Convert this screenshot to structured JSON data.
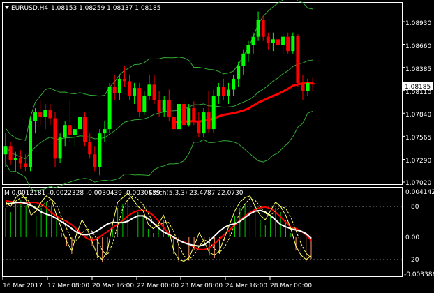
{
  "main_panel": {
    "title": "EURUSD,H4",
    "ohlc": "1.08153 1.08259 1.08137 1.08185",
    "price_ticks": [
      "1.08930",
      "1.08660",
      "1.08385",
      "1.08110",
      "1.07840",
      "1.07565",
      "1.07290",
      "1.07020"
    ],
    "current_price": "1.08185",
    "colors": {
      "bull": "#00ff00",
      "bear": "#ff0000",
      "bands": "#33aa33",
      "ma": "#ff0000",
      "grid": "#ffffff"
    }
  },
  "sub_panel": {
    "macd_label": "M 0.0012181 -0.0022328 -0.0030439 -0.0030439",
    "stoch_label": "Stoch(5,3,3) 23.4787 22.0730",
    "ticks": [
      "0.004142",
      "80",
      "0.00",
      "20",
      "-0.003386"
    ],
    "colors": {
      "hist_pos": "#00cc00",
      "hist_neg": "#ff9966",
      "red_line": "#ff0000",
      "white_line": "#ffffff",
      "stoch": "#ffff66"
    }
  },
  "time_axis": [
    "16 Mar 2017",
    "17 Mar 08:00",
    "20 Mar 16:00",
    "22 Mar 00:00",
    "23 Mar 08:00",
    "24 Mar 16:00",
    "28 Mar 00:00"
  ],
  "chart_data": {
    "type": "candlestick",
    "candles": [
      [
        1.0735,
        1.076,
        1.072,
        1.0745
      ],
      [
        1.0745,
        1.075,
        1.0722,
        1.0728
      ],
      [
        1.0728,
        1.0738,
        1.0715,
        1.0731
      ],
      [
        1.0731,
        1.074,
        1.0718,
        1.0724
      ],
      [
        1.0724,
        1.0735,
        1.0715,
        1.072
      ],
      [
        1.072,
        1.078,
        1.0715,
        1.0775
      ],
      [
        1.0775,
        1.079,
        1.076,
        1.0785
      ],
      [
        1.0785,
        1.08,
        1.077,
        1.078
      ],
      [
        1.078,
        1.0795,
        1.0765,
        1.0788
      ],
      [
        1.0788,
        1.0795,
        1.077,
        1.0778
      ],
      [
        1.0778,
        1.0785,
        1.072,
        1.073
      ],
      [
        1.073,
        1.076,
        1.0725,
        1.0755
      ],
      [
        1.0755,
        1.0775,
        1.0745,
        1.077
      ],
      [
        1.077,
        1.08,
        1.075,
        1.0758
      ],
      [
        1.0758,
        1.077,
        1.0745,
        1.0765
      ],
      [
        1.0765,
        1.079,
        1.075,
        1.078
      ],
      [
        1.078,
        1.0785,
        1.0745,
        1.075
      ],
      [
        1.075,
        1.076,
        1.073,
        1.0735
      ],
      [
        1.0735,
        1.0745,
        1.0715,
        1.072
      ],
      [
        1.072,
        1.0765,
        1.071,
        1.076
      ],
      [
        1.076,
        1.0775,
        1.075,
        1.0765
      ],
      [
        1.0765,
        1.082,
        1.076,
        1.0815
      ],
      [
        1.0815,
        1.083,
        1.08,
        1.0808
      ],
      [
        1.0808,
        1.083,
        1.08,
        1.0825
      ],
      [
        1.0825,
        1.084,
        1.0815,
        1.0822
      ],
      [
        1.0822,
        1.083,
        1.08,
        1.0805
      ],
      [
        1.0805,
        1.082,
        1.0795,
        1.0814
      ],
      [
        1.0814,
        1.082,
        1.078,
        1.0785
      ],
      [
        1.0785,
        1.081,
        1.0782,
        1.0805
      ],
      [
        1.0805,
        1.083,
        1.08,
        1.0818
      ],
      [
        1.0818,
        1.083,
        1.0795,
        1.08
      ],
      [
        1.08,
        1.081,
        1.078,
        1.0785
      ],
      [
        1.0785,
        1.0805,
        1.078,
        1.08
      ],
      [
        1.08,
        1.0812,
        1.0775,
        1.078
      ],
      [
        1.078,
        1.0795,
        1.076,
        1.0765
      ],
      [
        1.0765,
        1.08,
        1.076,
        1.0795
      ],
      [
        1.0795,
        1.0802,
        1.0768,
        1.077
      ],
      [
        1.077,
        1.0795,
        1.0768,
        1.079
      ],
      [
        1.079,
        1.0798,
        1.077,
        1.0775
      ],
      [
        1.0775,
        1.0785,
        1.0755,
        1.076
      ],
      [
        1.076,
        1.079,
        1.0755,
        1.0785
      ],
      [
        1.0785,
        1.081,
        1.076,
        1.0765
      ],
      [
        1.0765,
        1.0812,
        1.076,
        1.0805
      ],
      [
        1.0805,
        1.082,
        1.0795,
        1.0815
      ],
      [
        1.0815,
        1.0825,
        1.08,
        1.0805
      ],
      [
        1.0805,
        1.082,
        1.0795,
        1.0812
      ],
      [
        1.0812,
        1.083,
        1.0805,
        1.0825
      ],
      [
        1.0825,
        1.0845,
        1.0815,
        1.084
      ],
      [
        1.084,
        1.086,
        1.083,
        1.0855
      ],
      [
        1.0855,
        1.087,
        1.0845,
        1.0865
      ],
      [
        1.0865,
        1.088,
        1.0855,
        1.0875
      ],
      [
        1.0875,
        1.0905,
        1.087,
        1.0895
      ],
      [
        1.0895,
        1.09,
        1.087,
        1.0875
      ],
      [
        1.0875,
        1.088,
        1.086,
        1.0868
      ],
      [
        1.0868,
        1.088,
        1.0858,
        1.0872
      ],
      [
        1.0872,
        1.0878,
        1.086,
        1.0865
      ],
      [
        1.0865,
        1.088,
        1.0855,
        1.0875
      ],
      [
        1.0875,
        1.088,
        1.0855,
        1.0858
      ],
      [
        1.0858,
        1.088,
        1.0855,
        1.0876
      ],
      [
        1.0876,
        1.0878,
        1.0815,
        1.082
      ],
      [
        1.082,
        1.083,
        1.08,
        1.081
      ],
      [
        1.081,
        1.0825,
        1.0805,
        1.082
      ],
      [
        1.082,
        1.0826,
        1.081,
        1.0818
      ]
    ],
    "stoch_main": [
      85,
      80,
      90,
      95,
      88,
      70,
      75,
      85,
      92,
      88,
      70,
      55,
      40,
      30,
      50,
      65,
      55,
      40,
      25,
      20,
      30,
      60,
      85,
      90,
      95,
      88,
      80,
      75,
      60,
      55,
      60,
      70,
      55,
      30,
      20,
      18,
      22,
      35,
      50,
      40,
      28,
      25,
      30,
      45,
      60,
      75,
      85,
      90,
      92,
      80,
      70,
      65,
      75,
      85,
      80,
      70,
      55,
      35,
      25,
      20,
      24
    ],
    "stoch_signal": [
      82,
      84,
      86,
      90,
      90,
      82,
      78,
      80,
      85,
      88,
      82,
      68,
      55,
      42,
      42,
      50,
      55,
      52,
      42,
      30,
      25,
      38,
      58,
      78,
      88,
      92,
      88,
      82,
      72,
      62,
      58,
      62,
      62,
      52,
      36,
      24,
      20,
      25,
      35,
      42,
      40,
      32,
      28,
      34,
      45,
      60,
      73,
      83,
      89,
      87,
      80,
      72,
      70,
      75,
      80,
      78,
      68,
      53,
      38,
      27,
      22
    ]
  }
}
